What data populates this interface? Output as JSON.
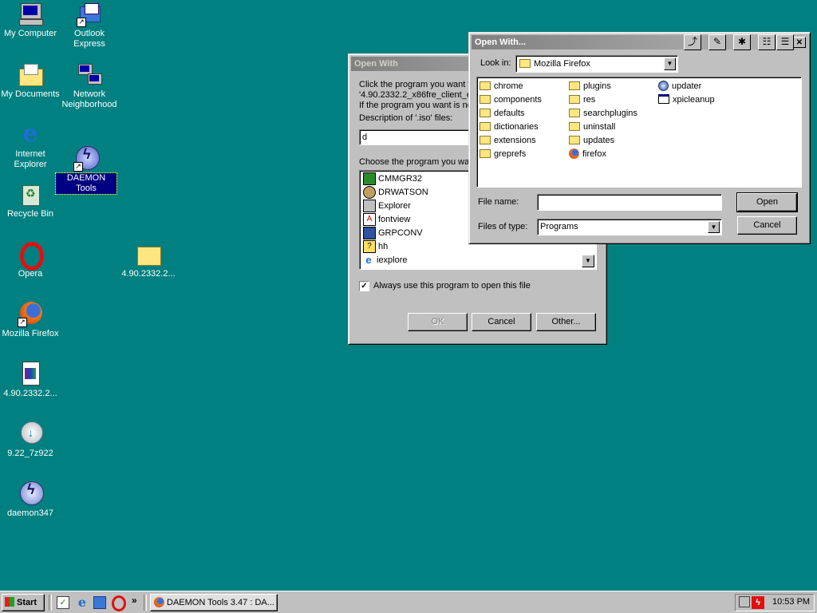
{
  "desktop": {
    "icons": [
      {
        "label": "My Computer",
        "icon": "computer-icon"
      },
      {
        "label": "Outlook Express",
        "icon": "outlook-express-icon"
      },
      {
        "label": "My Documents",
        "icon": "documents-folder-icon"
      },
      {
        "label": "Network Neighborhood",
        "icon": "network-icon"
      },
      {
        "label": "Internet Explorer",
        "icon": "internet-explorer-icon"
      },
      {
        "label": "DAEMON Tools",
        "icon": "daemon-tools-icon"
      },
      {
        "label": "Recycle Bin",
        "icon": "recycle-bin-icon"
      },
      {
        "label": "Opera",
        "icon": "opera-icon"
      },
      {
        "label": "4.90.2332.2...",
        "icon": "folder-icon"
      },
      {
        "label": "Mozilla Firefox",
        "icon": "firefox-icon"
      },
      {
        "label": "4.90.2332.2...",
        "icon": "archive-file-icon"
      },
      {
        "label": "9.22_7z922",
        "icon": "installer-icon"
      },
      {
        "label": "daemon347",
        "icon": "daemon-tools-icon"
      }
    ]
  },
  "open_with_dialog": {
    "title": "Open With",
    "instruction_line1": "Click the program you want to",
    "instruction_line2": "'4.90.2332.2_x86fre_client_e",
    "instruction_line3": "If the program you want is no",
    "description_label": "Description of '.iso' files:",
    "description_value": "d",
    "choose_label": "Choose the program you wan",
    "programs": [
      {
        "name": "CMMGR32",
        "icon": "cmmgr-icon"
      },
      {
        "name": "DRWATSON",
        "icon": "drwatson-icon"
      },
      {
        "name": "Explorer",
        "icon": "explorer-icon"
      },
      {
        "name": "fontview",
        "icon": "fontview-icon"
      },
      {
        "name": "GRPCONV",
        "icon": "grpconv-icon"
      },
      {
        "name": "hh",
        "icon": "help-icon"
      },
      {
        "name": "iexplore",
        "icon": "internet-explorer-icon"
      }
    ],
    "always_use_label": "Always use this program to open this file",
    "always_use_checked": true,
    "ok_label": "OK",
    "cancel_label": "Cancel",
    "other_label": "Other..."
  },
  "file_dialog": {
    "title": "Open With...",
    "look_in_label": "Look in:",
    "look_in_value": "Mozilla Firefox",
    "items_col1": [
      "chrome",
      "components",
      "defaults",
      "dictionaries",
      "extensions",
      "greprefs"
    ],
    "items_col2": [
      "plugins",
      "res",
      "searchplugins",
      "uninstall",
      "updates",
      "firefox"
    ],
    "items_col3": [
      "updater",
      "xpicleanup"
    ],
    "file_name_label": "File name:",
    "file_name_value": "",
    "files_of_type_label": "Files of type:",
    "files_of_type_value": "Programs",
    "open_label": "Open",
    "cancel_label": "Cancel",
    "help_button": "?",
    "close_button": "✕"
  },
  "taskbar": {
    "start_label": "Start",
    "task_label": "DAEMON Tools 3.47 : DA...",
    "chevron": "»",
    "clock": "10:53 PM"
  }
}
